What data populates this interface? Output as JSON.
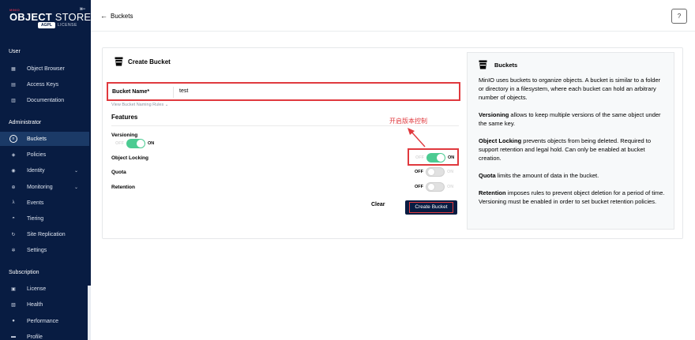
{
  "sidebar": {
    "logo": {
      "brand_small": "MINIO",
      "brand_bold": "OBJECT",
      "brand_rest": " STORE",
      "agpl": "AGPL",
      "license": "LICENSE"
    },
    "collapse_icon": "collapse-arrows-icon",
    "sections": [
      {
        "label": "User",
        "items": [
          {
            "label": "Object Browser",
            "icon": "object-browser-icon",
            "glyph": "▦"
          },
          {
            "label": "Access Keys",
            "icon": "key-icon",
            "glyph": "▤"
          },
          {
            "label": "Documentation",
            "icon": "document-icon",
            "glyph": "▥"
          }
        ]
      },
      {
        "label": "Administrator",
        "items": [
          {
            "label": "Buckets",
            "icon": "bucket-icon",
            "glyph": "≡",
            "active": true
          },
          {
            "label": "Policies",
            "icon": "shield-icon",
            "glyph": "◈"
          },
          {
            "label": "Identity",
            "icon": "identity-icon",
            "glyph": "◉",
            "chevron": "⌄"
          },
          {
            "label": "Monitoring",
            "icon": "search-icon",
            "glyph": "⊕",
            "chevron": "⌄"
          },
          {
            "label": "Events",
            "icon": "lambda-icon",
            "glyph": "λ"
          },
          {
            "label": "Tiering",
            "icon": "tiering-icon",
            "glyph": "◓"
          },
          {
            "label": "Site Replication",
            "icon": "replication-icon",
            "glyph": "↻"
          },
          {
            "label": "Settings",
            "icon": "gear-icon",
            "glyph": "✲"
          }
        ]
      },
      {
        "label": "Subscription",
        "items": [
          {
            "label": "License",
            "icon": "license-icon",
            "glyph": "▣"
          },
          {
            "label": "Health",
            "icon": "health-icon",
            "glyph": "▧"
          },
          {
            "label": "Performance",
            "icon": "performance-icon",
            "glyph": "●"
          },
          {
            "label": "Profile",
            "icon": "profile-icon",
            "glyph": "▬"
          }
        ]
      }
    ]
  },
  "header": {
    "back_label": "Buckets",
    "help_icon": "question-icon"
  },
  "form": {
    "title": "Create Bucket",
    "bucket_name_label": "Bucket Name*",
    "bucket_name_value": "test",
    "naming_rules": "View Bucket Naming Rules",
    "naming_rules_chevron": "⌄",
    "features_title": "Features",
    "features": {
      "versioning": {
        "label": "Versioning",
        "off": "OFF",
        "on": "ON",
        "state": true
      },
      "object_locking": {
        "label": "Object Locking",
        "off": "OFF",
        "on": "ON",
        "state": true
      },
      "quota": {
        "label": "Quota",
        "off": "OFF",
        "on": "ON",
        "state": false
      },
      "retention": {
        "label": "Retention",
        "off": "OFF",
        "on": "ON",
        "state": false
      }
    },
    "clear_label": "Clear",
    "create_label": "Create Bucket"
  },
  "annotation": {
    "text": "开启版本控制",
    "color": "#e0393e"
  },
  "info": {
    "title": "Buckets",
    "p1": "MinIO uses buckets to organize objects. A bucket is similar to a folder or directory in a filesystem, where each bucket can hold an arbitrary number of objects.",
    "p2_bold": "Versioning",
    "p2": " allows to keep multiple versions of the same object under the same key.",
    "p3_bold": "Object Locking",
    "p3": " prevents objects from being deleted. Required to support retention and legal hold. Can only be enabled at bucket creation.",
    "p4_bold": "Quota",
    "p4": " limits the amount of data in the bucket.",
    "p5_bold": "Retention",
    "p5": " imposes rules to prevent object deletion for a period of time. Versioning must be enabled in order to set bucket retention policies."
  },
  "colors": {
    "sidebar_bg": "#081c42",
    "active_item": "#1b3a67",
    "toggle_on": "#4ccb92",
    "annotation_red": "#e0393e"
  }
}
